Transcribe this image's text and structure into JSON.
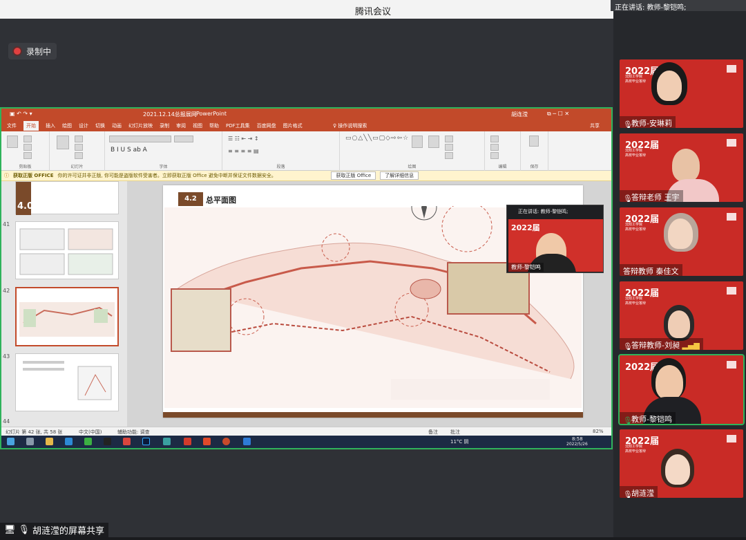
{
  "app": {
    "title": "腾讯会议",
    "talking_banner": "正在讲话: 教师-黎铠鸣;"
  },
  "recording": {
    "label": "录制中"
  },
  "ppt": {
    "doc_title": "2021.12.14总报展网",
    "app_name": "PowerPoint",
    "user": "胡连滢",
    "tabs": [
      "文件",
      "开始",
      "插入",
      "绘图",
      "设计",
      "切换",
      "动画",
      "幻灯片放映",
      "录制",
      "审阅",
      "视图",
      "帮助",
      "PDF工具集",
      "百度网盘",
      "图片格式"
    ],
    "active_tab": "开始",
    "search": "操作说明搜索",
    "share": "共享",
    "groups": [
      "剪贴板",
      "幻灯片",
      "字体",
      "段落",
      "绘图",
      "编辑",
      "保存"
    ],
    "warning": {
      "tag": "获取正版 OFFICE",
      "text": "你的许可证并非正版, 你可能是盗版软件受害者。立即获取正版 Office 避免中断并保证文件数据安全。",
      "btn1": "获取正版 Office",
      "btn2": "了解详细信息"
    },
    "slide": {
      "number": "4.2",
      "title": "总平面图"
    },
    "thumbs": [
      {
        "num": "41"
      },
      {
        "num": "42"
      },
      {
        "num": "43"
      },
      {
        "num": "44"
      }
    ],
    "thumb_top_label": "4.0",
    "status": {
      "slide_info": "幻灯片 第 42 张, 共 58 张",
      "lang": "中文(中国)",
      "access": "辅助功能: 调查",
      "notes": "备注",
      "comments": "批注",
      "zoom": "82%"
    },
    "taskbar": {
      "weather": "11°C 阴",
      "time": "8:58",
      "date": "2022/5/26"
    }
  },
  "inset": {
    "banner": "正在讲话: 教师-黎铠鸣;",
    "name": "教师-黎铠鸣"
  },
  "tile_text": {
    "year": "2022届",
    "line1": "沈阳工学院",
    "line2": "高校毕业答辩"
  },
  "participants": [
    {
      "name": "教师-安琳莉"
    },
    {
      "name": "答辩老师 王宇"
    },
    {
      "name": "答辩教师 秦佳文"
    },
    {
      "name": "答辩教师-刘昶"
    },
    {
      "name": "教师-黎铠鸣"
    },
    {
      "name": "胡涟滢"
    }
  ],
  "share_label": "胡涟滢的屏幕共享"
}
